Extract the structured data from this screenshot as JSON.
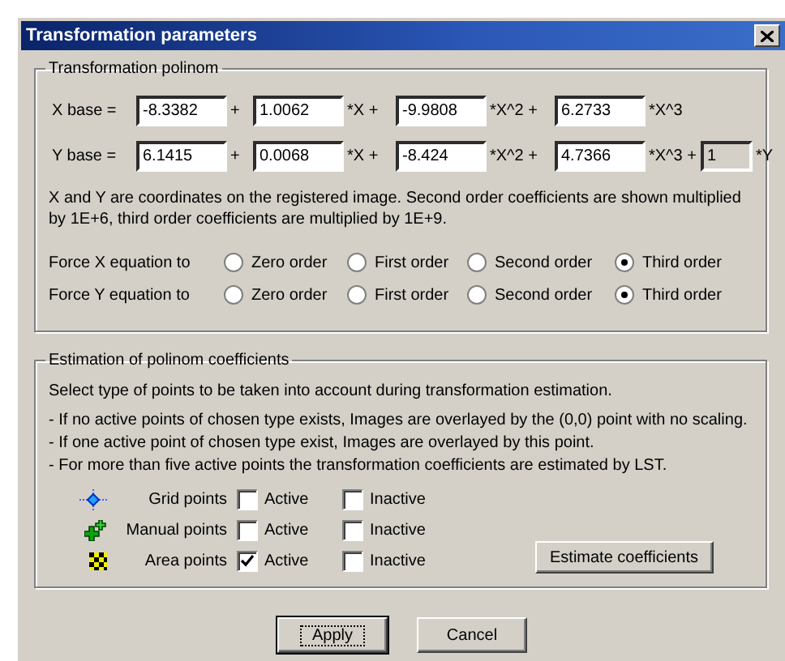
{
  "window": {
    "title": "Transformation parameters"
  },
  "polynom": {
    "title": "Transformation polinom",
    "equations": [
      {
        "parts": [
          {
            "kind": "label",
            "text": "X base ="
          },
          {
            "kind": "field",
            "value": "-8.3382",
            "disabled": false
          },
          {
            "kind": "label",
            "text": "+"
          },
          {
            "kind": "field",
            "value": "1.0062",
            "disabled": false
          },
          {
            "kind": "label",
            "text": "*X +"
          },
          {
            "kind": "field",
            "value": "-9.9808",
            "disabled": false
          },
          {
            "kind": "label",
            "text": "*X^2 +"
          },
          {
            "kind": "field",
            "value": "6.2733",
            "disabled": false
          },
          {
            "kind": "label",
            "text": "*X^3"
          }
        ]
      },
      {
        "parts": [
          {
            "kind": "label",
            "text": "Y base ="
          },
          {
            "kind": "field",
            "value": "6.1415",
            "disabled": false
          },
          {
            "kind": "label",
            "text": "+"
          },
          {
            "kind": "field",
            "value": "0.0068",
            "disabled": false
          },
          {
            "kind": "label",
            "text": "*X +"
          },
          {
            "kind": "field",
            "value": "-8.424",
            "disabled": false
          },
          {
            "kind": "label",
            "text": "*X^2 +"
          },
          {
            "kind": "field",
            "value": "4.7366",
            "disabled": false
          },
          {
            "kind": "label",
            "text": "*X^3 +"
          },
          {
            "kind": "field",
            "value": "1",
            "disabled": true
          },
          {
            "kind": "label",
            "text": "*Y"
          }
        ]
      }
    ],
    "note": "X and Y are coordinates on the registered image. Second order coefficients are shown multiplied by 1E+6, third order coefficients are multiplied by 1E+9.",
    "force": [
      {
        "label": "Force X equation to",
        "options": [
          {
            "label": "Zero order",
            "selected": false
          },
          {
            "label": "First order",
            "selected": false
          },
          {
            "label": "Second order",
            "selected": false
          },
          {
            "label": "Third order",
            "selected": true
          }
        ]
      },
      {
        "label": "Force Y equation to",
        "options": [
          {
            "label": "Zero order",
            "selected": false
          },
          {
            "label": "First order",
            "selected": false
          },
          {
            "label": "Second order",
            "selected": false
          },
          {
            "label": "Third order",
            "selected": true
          }
        ]
      }
    ]
  },
  "estimation": {
    "title": "Estimation of polinom coefficients",
    "intro": "Select type of points to be taken into account during transformation estimation.",
    "bullets": [
      "- If no active points of chosen type exists, Images are overlayed by the (0,0) point with no scaling.",
      "- If one active point of chosen type exist, Images are overlayed by this point.",
      "- For more than five active points the transformation coefficients are estimated by LST."
    ],
    "point_types": [
      {
        "kind": "grid",
        "label": "Grid points",
        "active": {
          "label": "Active",
          "checked": false
        },
        "inactive": {
          "label": "Inactive",
          "checked": false
        }
      },
      {
        "kind": "manual",
        "label": "Manual points",
        "active": {
          "label": "Active",
          "checked": false
        },
        "inactive": {
          "label": "Inactive",
          "checked": false
        }
      },
      {
        "kind": "area",
        "label": "Area points",
        "active": {
          "label": "Active",
          "checked": true
        },
        "inactive": {
          "label": "Inactive",
          "checked": false
        }
      }
    ],
    "estimate_button": "Estimate coefficients"
  },
  "buttons": [
    {
      "label": "Apply",
      "default": true
    },
    {
      "label": "Cancel",
      "default": false
    }
  ]
}
